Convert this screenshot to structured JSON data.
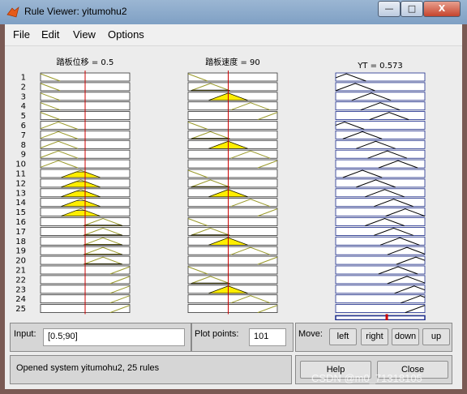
{
  "window": {
    "title": "Rule Viewer: yitumohu2"
  },
  "titlebar_buttons": {
    "minimize": "—",
    "maximize": "□",
    "close": "X"
  },
  "menu": [
    "File",
    "Edit",
    "View",
    "Options"
  ],
  "columns": [
    {
      "header": "踏板位移 = 0.5",
      "input_value": 0.5,
      "range": [
        0,
        1
      ],
      "lines": [
        0.5
      ]
    },
    {
      "header": "踏板速度 = 90",
      "input_value": 90,
      "range": [
        0,
        200
      ],
      "lines": [
        90
      ]
    },
    {
      "header": "YT = 0.573",
      "output_value": 0.573,
      "range": [
        0,
        1
      ],
      "lines": [
        0.573
      ]
    }
  ],
  "rules": [
    "1",
    "2",
    "3",
    "4",
    "5",
    "6",
    "7",
    "8",
    "9",
    "10",
    "11",
    "12",
    "13",
    "14",
    "15",
    "16",
    "17",
    "18",
    "19",
    "20",
    "21",
    "22",
    "23",
    "24",
    "25"
  ],
  "input_panel": {
    "label": "Input:",
    "value": "[0.5;90]"
  },
  "plot_points": {
    "label": "Plot points:",
    "value": "101"
  },
  "move_panel": {
    "label": "Move:",
    "buttons": [
      "left",
      "right",
      "down",
      "up"
    ]
  },
  "status": {
    "text": "Opened system yitumohu2, 25 rules"
  },
  "buttons": {
    "help": "Help",
    "close": "Close"
  },
  "watermark": "CSDN @m0_71318105",
  "colors": {
    "mf_line": "#9a9a2a",
    "fill": "#ffee00",
    "cursor": "#cc0000",
    "out_line": "#1a2a8a",
    "grid_frame": "#000000"
  }
}
